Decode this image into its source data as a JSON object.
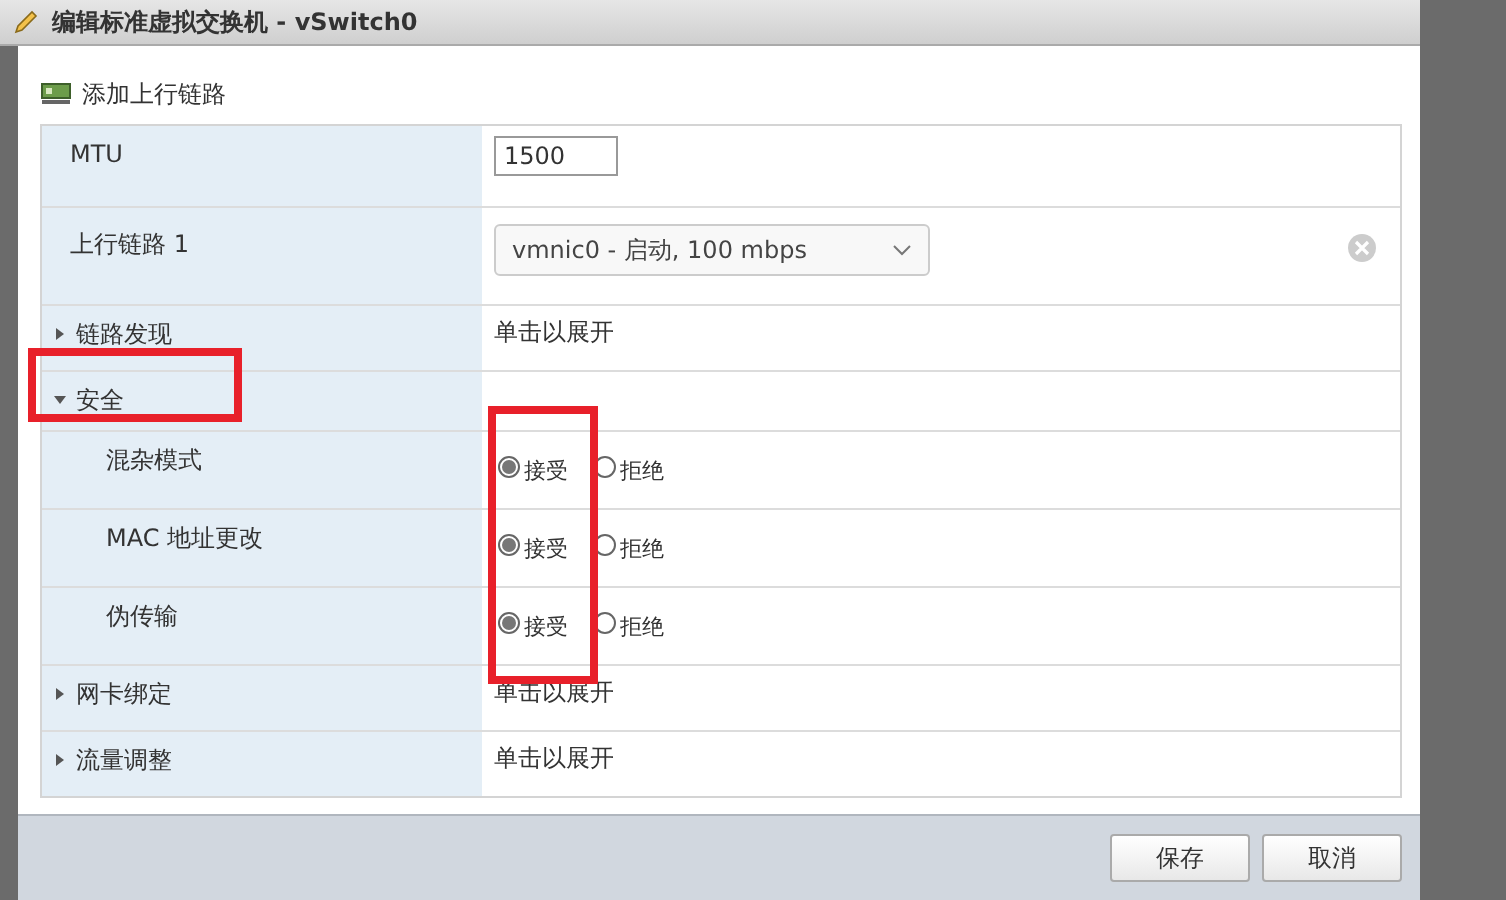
{
  "window": {
    "title": "编辑标准虚拟交换机 - vSwitch0"
  },
  "toolbar": {
    "add_uplink": "添加上行链路"
  },
  "rows": [
    {
      "kind": "input",
      "label": "MTU",
      "value": "1500"
    },
    {
      "kind": "select",
      "label": "上行链路 1",
      "value": "vmnic0 - 启动, 100 mbps"
    },
    {
      "kind": "section",
      "label": "链路发现",
      "expanded": false,
      "hint": "单击以展开"
    },
    {
      "kind": "section",
      "label": "安全",
      "expanded": true,
      "highlighted": true,
      "children": [
        {
          "label": "混杂模式",
          "options": [
            {
              "label": "接受",
              "selected": true
            },
            {
              "label": "拒绝",
              "selected": false
            }
          ]
        },
        {
          "label": "MAC 地址更改",
          "options": [
            {
              "label": "接受",
              "selected": true
            },
            {
              "label": "拒绝",
              "selected": false
            }
          ]
        },
        {
          "label": "伪传输",
          "options": [
            {
              "label": "接受",
              "selected": true
            },
            {
              "label": "拒绝",
              "selected": false
            }
          ]
        }
      ]
    },
    {
      "kind": "section",
      "label": "网卡绑定",
      "expanded": false,
      "hint": "单击以展开"
    },
    {
      "kind": "section",
      "label": "流量调整",
      "expanded": false,
      "hint": "单击以展开"
    }
  ],
  "buttons": [
    {
      "label": "保存"
    },
    {
      "label": "取消"
    }
  ]
}
